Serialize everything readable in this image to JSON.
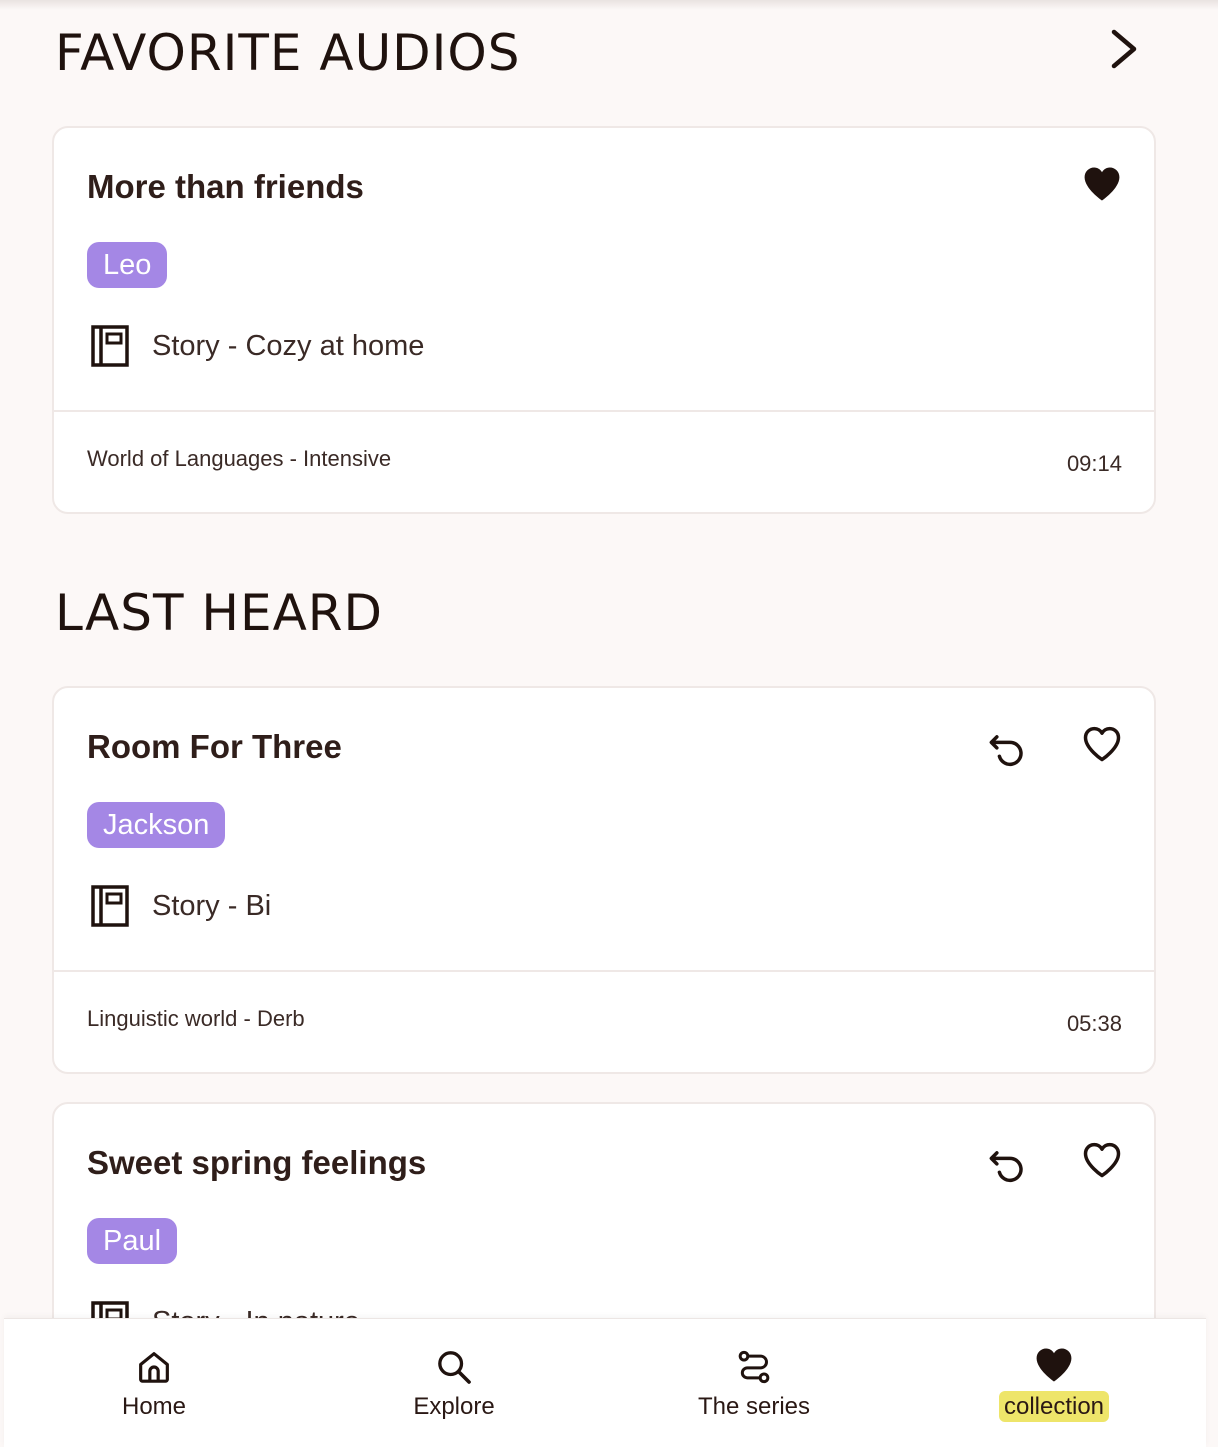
{
  "favorites": {
    "title": "FAVORITE AUDIOS",
    "card": {
      "title": "More than friends",
      "tag": "Leo",
      "meta": "Story -  Cozy at home",
      "series": "World of Languages - Intensive",
      "duration": "09:14",
      "favorited": true
    }
  },
  "last_heard": {
    "title": "LAST HEARD",
    "cards": [
      {
        "title": "Room For Three",
        "tag": "Jackson",
        "meta": "Story - Bi",
        "series": "Linguistic world - Derb",
        "duration": "05:38",
        "favorited": false
      },
      {
        "title": "Sweet spring feelings",
        "tag": "Paul",
        "meta": "Story -  In nature",
        "favorited": false
      }
    ]
  },
  "nav": {
    "items": [
      {
        "label": "Home",
        "icon": "home-icon"
      },
      {
        "label": "Explore",
        "icon": "search-icon"
      },
      {
        "label": "The series",
        "icon": "series-icon"
      },
      {
        "label": "collection",
        "icon": "heart-icon",
        "active": true
      }
    ]
  },
  "colors": {
    "background": "#fcf8f7",
    "tag": "#a487e5",
    "active_highlight": "#eee56a",
    "text": "#2a1814"
  }
}
